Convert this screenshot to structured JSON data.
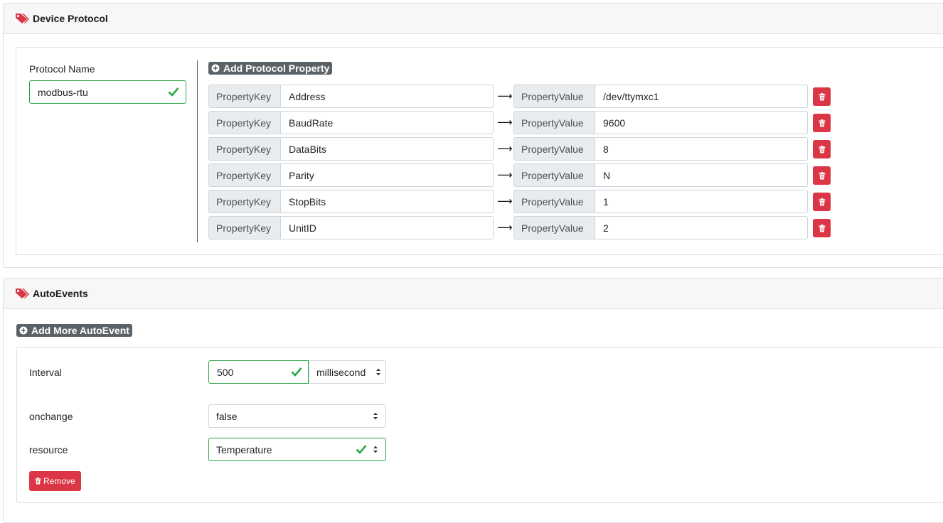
{
  "device_protocol": {
    "title": "Device Protocol",
    "protocol_name_label": "Protocol Name",
    "protocol_name_value": "modbus-rtu",
    "add_property_label": "Add Protocol Property",
    "key_addon": "PropertyKey",
    "value_addon": "PropertyValue",
    "arrow": "⟶",
    "properties": [
      {
        "key": "Address",
        "value": "/dev/ttymxc1"
      },
      {
        "key": "BaudRate",
        "value": "9600"
      },
      {
        "key": "DataBits",
        "value": "8"
      },
      {
        "key": "Parity",
        "value": "N"
      },
      {
        "key": "StopBits",
        "value": "1"
      },
      {
        "key": "UnitID",
        "value": "2"
      }
    ]
  },
  "auto_events": {
    "title": "AutoEvents",
    "add_more_label": "Add More AutoEvent",
    "interval_label": "Interval",
    "interval_value": "500",
    "interval_unit": "millisecond",
    "onchange_label": "onchange",
    "onchange_value": "false",
    "resource_label": "resource",
    "resource_value": "Temperature",
    "remove_label": "Remove"
  },
  "colors": {
    "danger": "#dc3545",
    "success": "#28a745",
    "secondary": "#5a6268",
    "header_bg": "#f7f7f7"
  },
  "icons": {
    "header": "tags-icon",
    "add": "plus-circle-icon",
    "delete": "trash-icon",
    "valid": "check-icon",
    "select": "updown-caret-icon"
  }
}
